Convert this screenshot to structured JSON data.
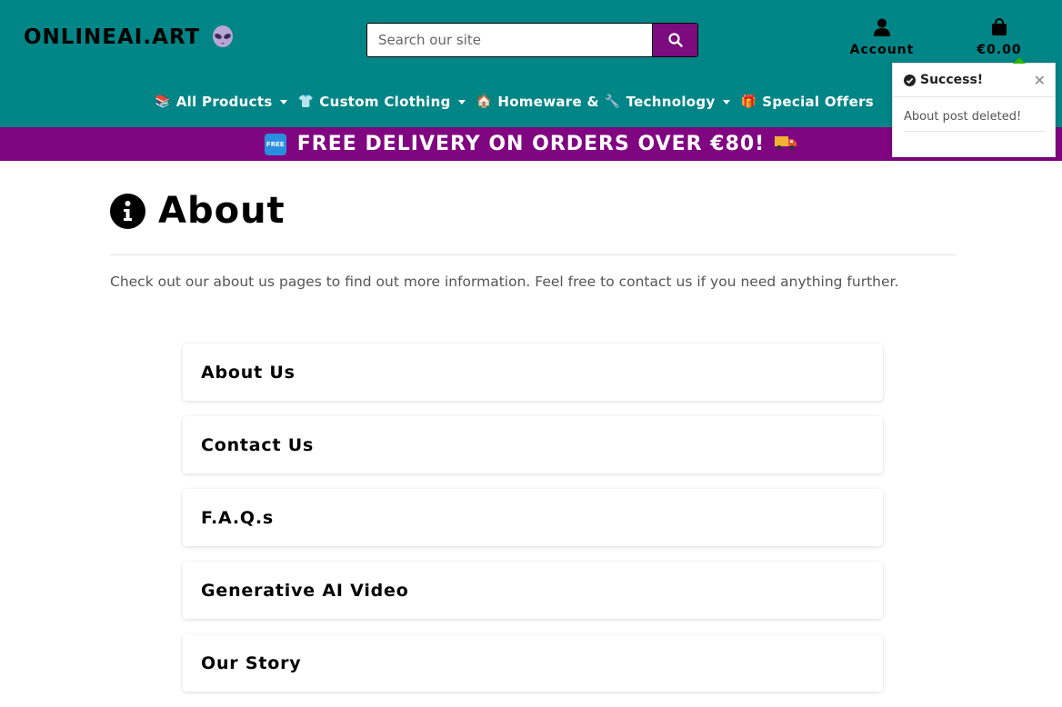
{
  "header": {
    "brand": "ONLINEAI.ART",
    "search": {
      "placeholder": "Search our site"
    },
    "account_label": "Account",
    "cart_total": "€0.00"
  },
  "nav": {
    "items": [
      {
        "emoji": "📚",
        "label": "All Products",
        "has_dropdown": true
      },
      {
        "emoji": "👕",
        "label": "Custom Clothing",
        "has_dropdown": true
      },
      {
        "emoji": "🏠",
        "label": "Homeware &",
        "has_dropdown": false
      },
      {
        "emoji": "🔧",
        "label": "Technology",
        "has_dropdown": true
      },
      {
        "emoji": "🎁",
        "label": "Special Offers",
        "has_dropdown": false
      }
    ]
  },
  "promo": {
    "badge": "FREE",
    "text": "FREE DELIVERY ON ORDERS OVER €80!",
    "emoji": "🚚"
  },
  "toast": {
    "title": "Success!",
    "message": "About post deleted!"
  },
  "main": {
    "title": "About",
    "intro": "Check out our about us pages to find out more information. Feel free to contact us if you need anything further.",
    "cards": [
      {
        "label": "About Us"
      },
      {
        "label": "Contact Us"
      },
      {
        "label": "F.A.Q.s"
      },
      {
        "label": "Generative AI Video"
      },
      {
        "label": "Our Story"
      }
    ]
  },
  "colors": {
    "header_bg": "#018586",
    "search_button": "#7b0b7e",
    "promo_bg": "#800580",
    "toast_accent": "#2db300"
  }
}
